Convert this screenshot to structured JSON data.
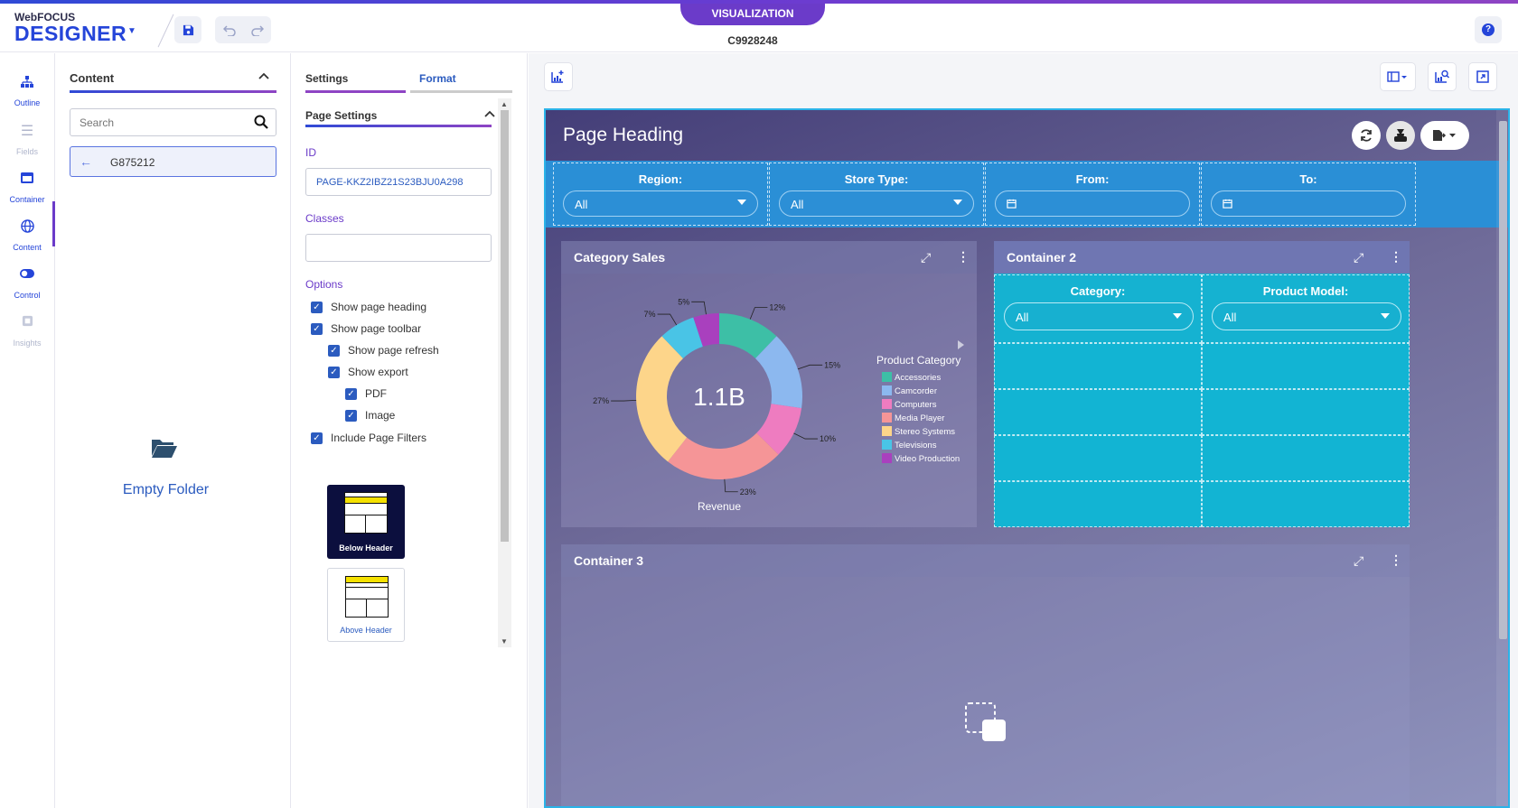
{
  "header": {
    "brand_small": "WebFOCUS",
    "brand_big": "DESIGNER",
    "mode_tab": "VISUALIZATION",
    "document_id": "C9928248",
    "help_label": "?"
  },
  "leftnav": {
    "items": [
      {
        "label": "Outline",
        "icon": "outline-icon",
        "state": "normal"
      },
      {
        "label": "Fields",
        "icon": "fields-icon",
        "state": "disabled"
      },
      {
        "label": "Container",
        "icon": "container-icon",
        "state": "normal"
      },
      {
        "label": "Content",
        "icon": "content-icon",
        "state": "active"
      },
      {
        "label": "Control",
        "icon": "control-icon",
        "state": "normal"
      },
      {
        "label": "Insights",
        "icon": "insights-icon",
        "state": "disabled"
      }
    ]
  },
  "content_panel": {
    "title": "Content",
    "search_placeholder": "Search",
    "back_label": "G875212",
    "empty_label": "Empty Folder"
  },
  "settings_panel": {
    "tab_settings": "Settings",
    "tab_format": "Format",
    "section_title": "Page Settings",
    "id_label": "ID",
    "id_value": "PAGE-KKZ2IBZ21S23BJU0A298",
    "classes_label": "Classes",
    "classes_value": "",
    "options_label": "Options",
    "options": [
      {
        "label": "Show page heading",
        "checked": true,
        "indent": 0
      },
      {
        "label": "Show page toolbar",
        "checked": true,
        "indent": 0
      },
      {
        "label": "Show page refresh",
        "checked": true,
        "indent": 1
      },
      {
        "label": "Show export",
        "checked": true,
        "indent": 1
      },
      {
        "label": "PDF",
        "checked": true,
        "indent": 2
      },
      {
        "label": "Image",
        "checked": true,
        "indent": 2
      },
      {
        "label": "Include Page Filters",
        "checked": true,
        "indent": 0
      }
    ],
    "filter_position": {
      "below": "Below Header",
      "above": "Above Header",
      "selected": "Below Header"
    }
  },
  "canvas": {
    "page_heading": "Page Heading",
    "filters": [
      {
        "label": "Region:",
        "value": "All",
        "type": "select"
      },
      {
        "label": "Store Type:",
        "value": "All",
        "type": "select"
      },
      {
        "label": "From:",
        "value": "",
        "type": "date"
      },
      {
        "label": "To:",
        "value": "",
        "type": "date"
      }
    ],
    "container1_title": "Category Sales",
    "container2_title": "Container 2",
    "container2_filters": [
      {
        "label": "Category:",
        "value": "All"
      },
      {
        "label": "Product Model:",
        "value": "All"
      }
    ],
    "container3_title": "Container 3"
  },
  "chart_data": {
    "type": "pie",
    "center_label": "1.1B",
    "xlabel": "Revenue",
    "legend_title": "Product Category",
    "legend_position": "right",
    "categories": [
      "Accessories",
      "Camcorder",
      "Computers",
      "Media Player",
      "Stereo Systems",
      "Televisions",
      "Video Production"
    ],
    "values": [
      12,
      15,
      10,
      23,
      27,
      7,
      5
    ],
    "value_labels": [
      "12%",
      "15%",
      "10%",
      "23%",
      "27%",
      "7%",
      "5%"
    ],
    "colors": [
      "#3dbfa6",
      "#8cb8ef",
      "#ee7cc0",
      "#f59597",
      "#fdd58a",
      "#49c4e6",
      "#a940be"
    ]
  }
}
